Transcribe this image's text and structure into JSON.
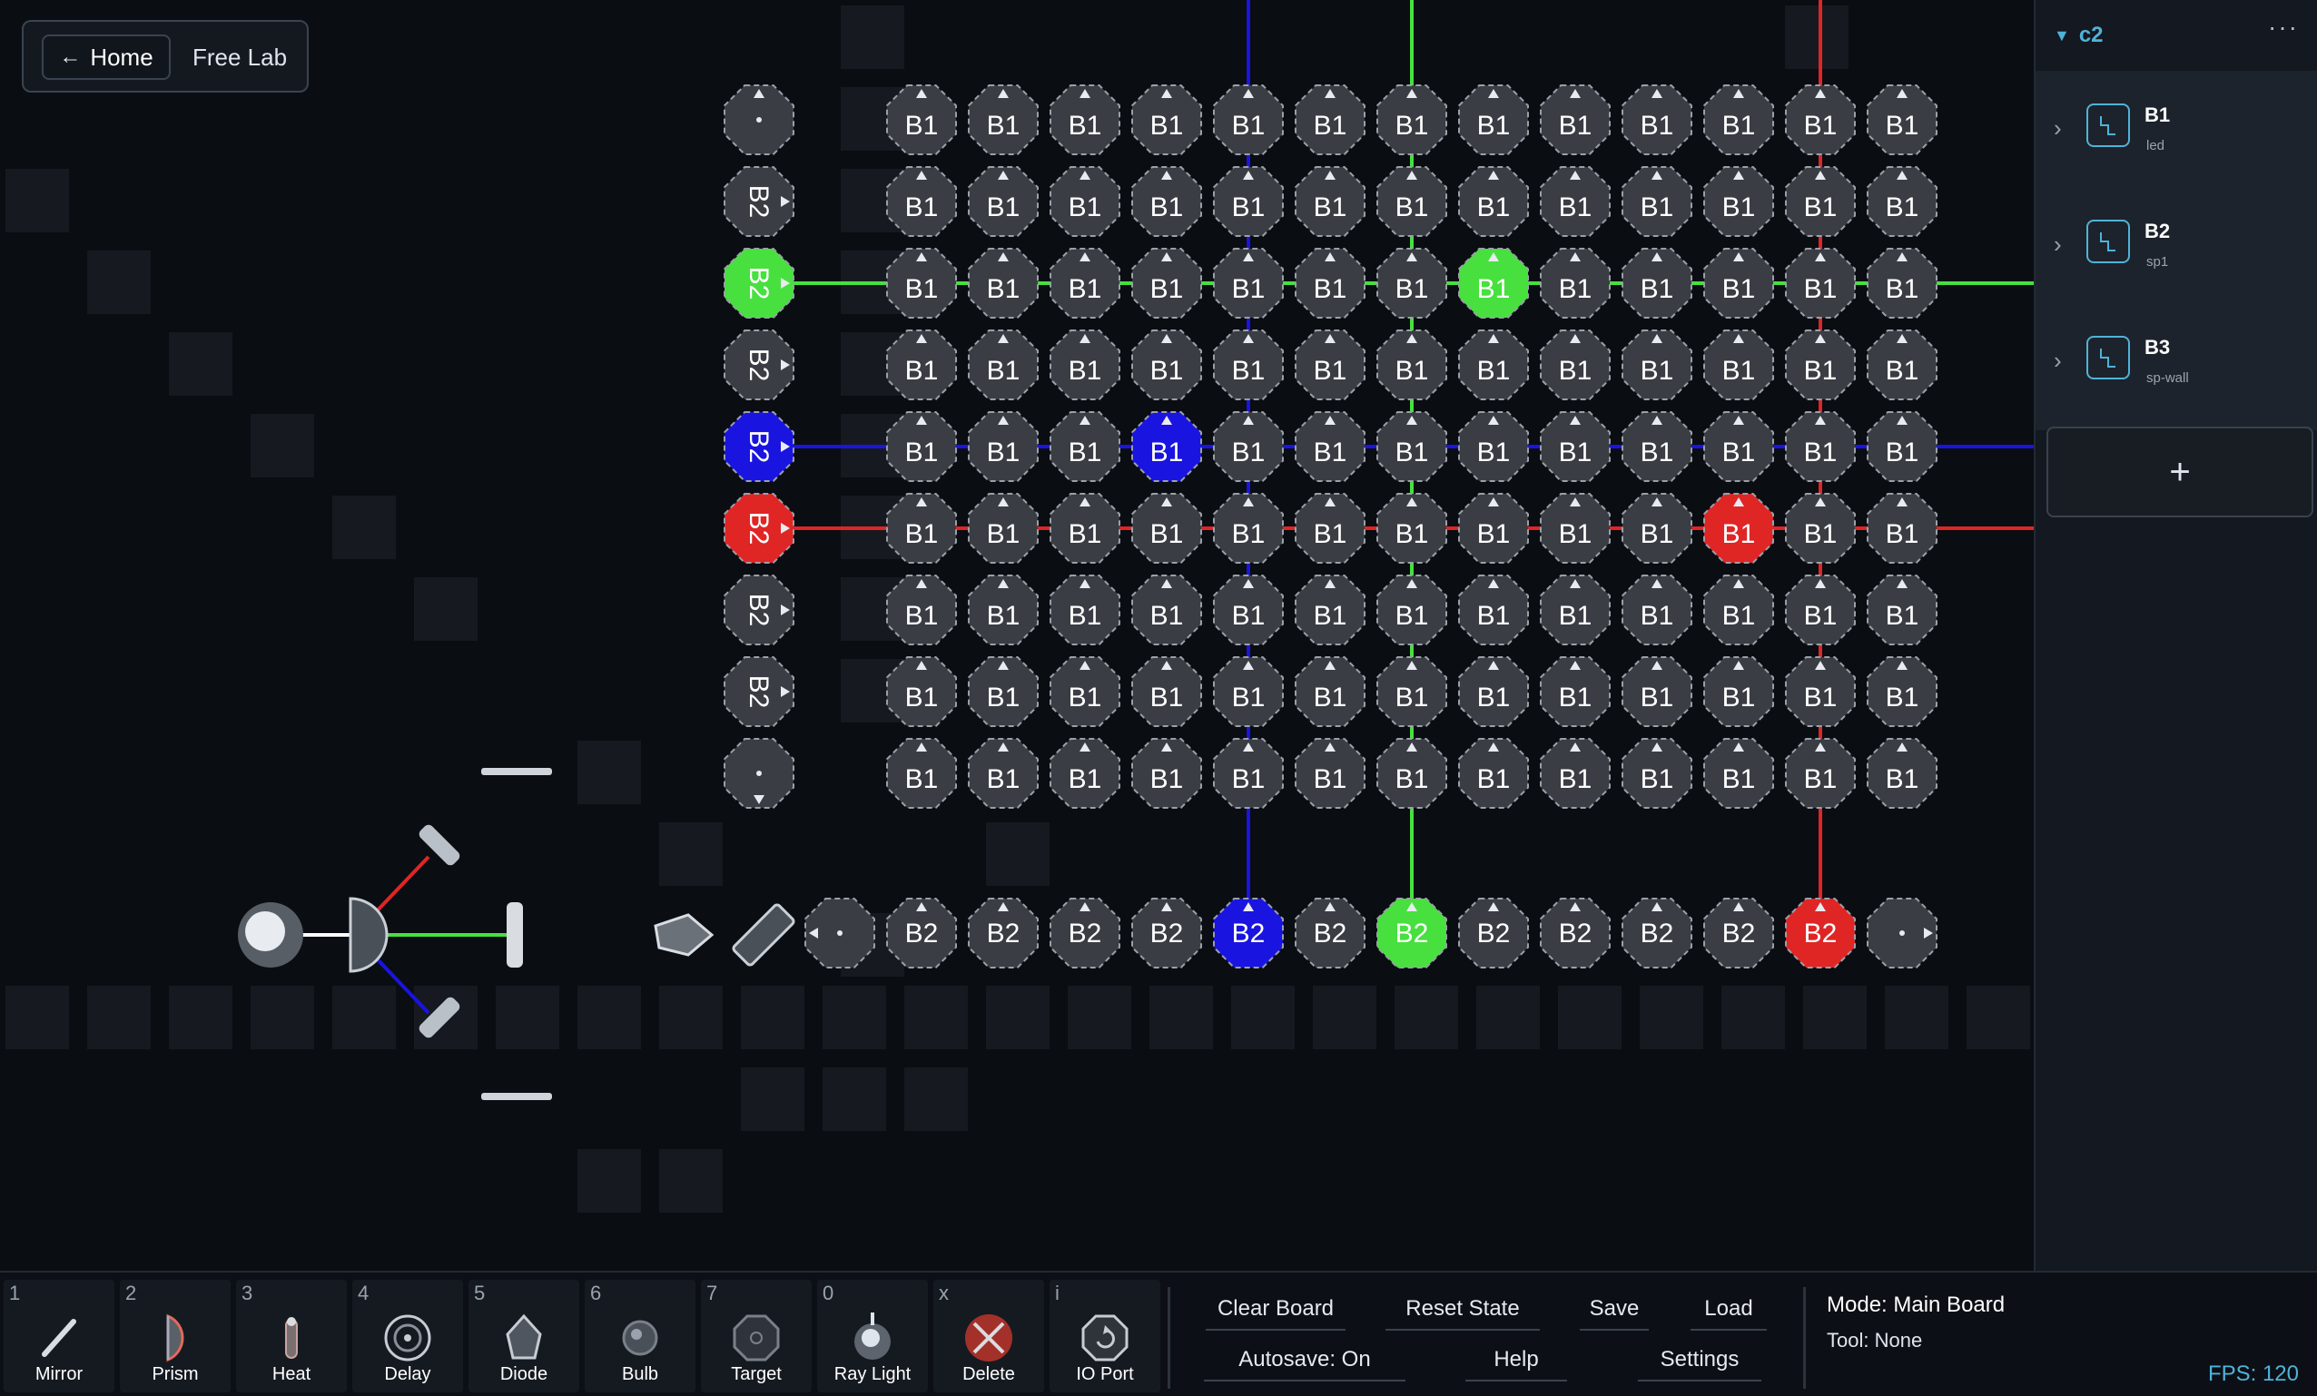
{
  "nav": {
    "home_label": "Home",
    "title": "Free Lab"
  },
  "sidebar": {
    "circuit_name": "c2",
    "items": [
      {
        "label": "B1",
        "sub": "led"
      },
      {
        "label": "B2",
        "sub": "sp1"
      },
      {
        "label": "B3",
        "sub": "sp-wall"
      }
    ],
    "add_label": "+"
  },
  "board": {
    "grid": {
      "cols": 13,
      "rows": 9,
      "cell_label": "B1"
    },
    "left_column_labels": [
      "",
      "B2",
      "B2",
      "B2",
      "B2",
      "B2",
      "B2",
      "B2",
      ""
    ],
    "bottom_row": {
      "cells": 13,
      "label": "B2"
    },
    "colors": {
      "green": "#47e03f",
      "blue": "#1a14e0",
      "red": "#e02525",
      "white": "#ffffff",
      "tile": "#3a3d43",
      "grid_square": "#161a20"
    },
    "beams": {
      "green": {
        "row": 2,
        "col": 6
      },
      "blue": {
        "row": 4,
        "col": 4
      },
      "red": {
        "row": 5,
        "col": 11
      }
    },
    "lit_grid_cells": [
      {
        "row": 2,
        "col": 7,
        "color": "green"
      },
      {
        "row": 4,
        "col": 3,
        "color": "blue"
      },
      {
        "row": 5,
        "col": 10,
        "color": "red"
      }
    ]
  },
  "toolbar": {
    "tools": [
      {
        "key": "1",
        "label": "Mirror",
        "icon": "mirror-icon"
      },
      {
        "key": "2",
        "label": "Prism",
        "icon": "prism-icon"
      },
      {
        "key": "3",
        "label": "Heat",
        "icon": "heat-icon"
      },
      {
        "key": "4",
        "label": "Delay",
        "icon": "delay-icon"
      },
      {
        "key": "5",
        "label": "Diode",
        "icon": "diode-icon"
      },
      {
        "key": "6",
        "label": "Bulb",
        "icon": "bulb-icon"
      },
      {
        "key": "7",
        "label": "Target",
        "icon": "target-icon"
      },
      {
        "key": "0",
        "label": "Ray Light",
        "icon": "ray-light-icon"
      },
      {
        "key": "x",
        "label": "Delete",
        "icon": "delete-icon"
      },
      {
        "key": "i",
        "label": "IO Port",
        "icon": "io-port-icon"
      }
    ],
    "controls": {
      "clear": "Clear Board",
      "reset": "Reset State",
      "save": "Save",
      "load": "Load",
      "autosave": "Autosave: On",
      "help": "Help",
      "settings": "Settings"
    },
    "status": {
      "mode": "Mode: Main Board",
      "tool": "Tool: None",
      "fps": "FPS: 120"
    }
  }
}
